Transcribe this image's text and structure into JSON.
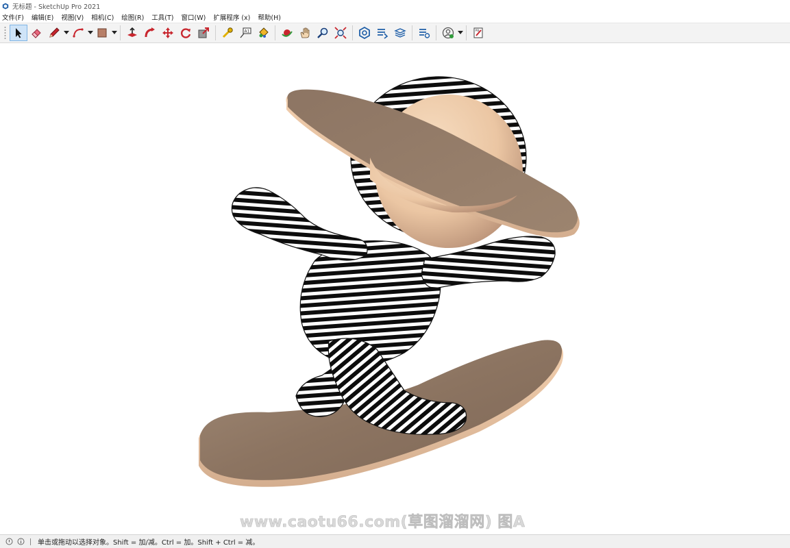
{
  "window": {
    "title": "无标题 - SketchUp Pro 2021"
  },
  "menu": [
    {
      "label": "文件(F)"
    },
    {
      "label": "编辑(E)"
    },
    {
      "label": "视图(V)"
    },
    {
      "label": "相机(C)"
    },
    {
      "label": "绘图(R)"
    },
    {
      "label": "工具(T)"
    },
    {
      "label": "窗口(W)"
    },
    {
      "label": "扩展程序 (x)"
    },
    {
      "label": "帮助(H)"
    }
  ],
  "toolbar": {
    "active_tool": "select",
    "icons": [
      "select-icon",
      "eraser-icon",
      "pencil-icon",
      "arc-icon",
      "shape-icon",
      "push-pull-icon",
      "follow-me-icon",
      "move-icon",
      "rotate-icon",
      "scale-icon",
      "tape-measure-icon",
      "text-icon",
      "paint-bucket-icon",
      "orbit-icon",
      "pan-icon",
      "zoom-icon",
      "zoom-extents-icon",
      "warehouse-icon",
      "extension-warehouse-icon",
      "layout-icon",
      "extension-manager-icon",
      "profile-icon",
      "send-to-layout-icon"
    ]
  },
  "watermark": {
    "text": "www.caotu66.com(草图溜溜网) 图A"
  },
  "status": {
    "text": "单击或拖动以选择对象。Shift = 加/减。Ctrl = 加。Shift + Ctrl = 减。"
  },
  "colors": {
    "accent": "#cfe4f8",
    "model_skin": "#f0cfae",
    "model_brown": "#8c7461",
    "toolbar_bg": "#f3f3f3"
  }
}
